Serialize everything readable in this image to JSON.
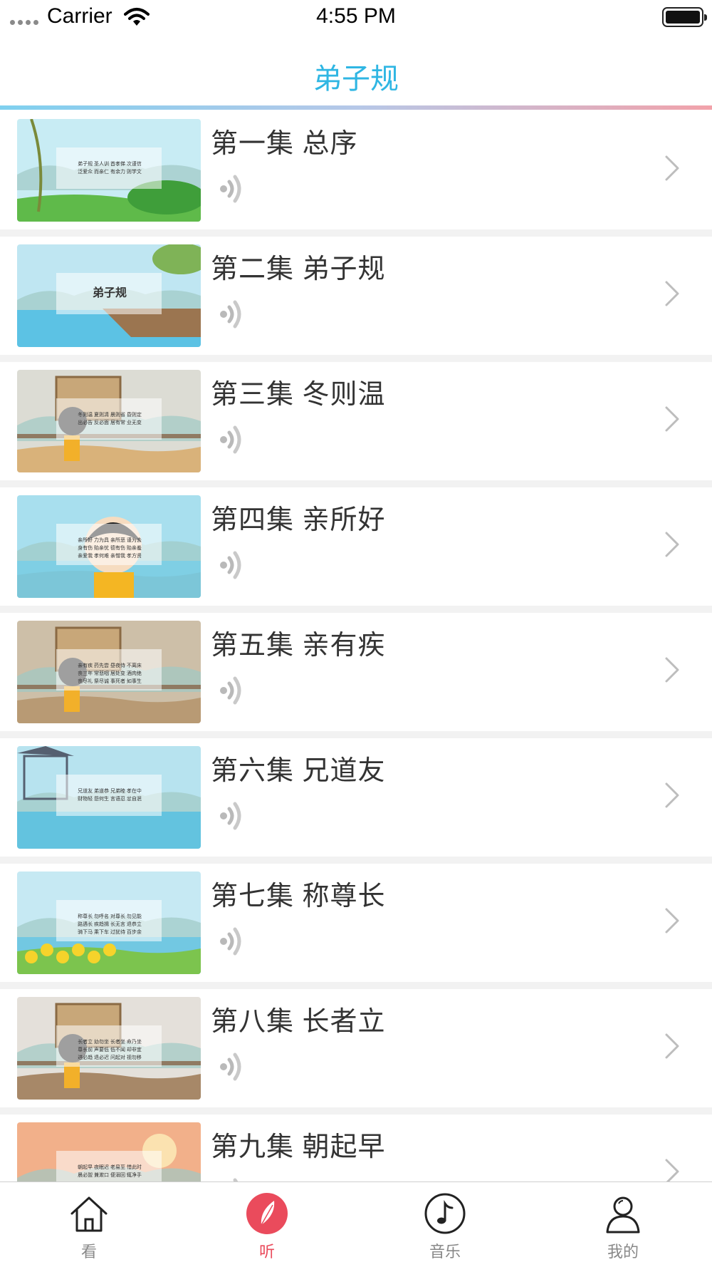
{
  "status": {
    "carrier": "Carrier",
    "time": "4:55 PM"
  },
  "nav": {
    "title": "弟子规"
  },
  "episodes": [
    {
      "title": "第一集 总序",
      "thumb_text": [
        "弟子规 圣人训 首孝悌 次谨信",
        "泛爱众 而亲仁 有余力 则学文"
      ]
    },
    {
      "title": "第二集 弟子规",
      "thumb_text": [
        "弟子规"
      ]
    },
    {
      "title": "第三集 冬则温",
      "thumb_text": [
        "冬则温 夏则凊 晨则省 昏则定",
        "出必告 反必面 居有常 业无变"
      ]
    },
    {
      "title": "第四集 亲所好",
      "thumb_text": [
        "亲所好 力为具 亲所恶 谨为去",
        "身有伤 贻亲忧 德有伤 贻亲羞",
        "亲爱我 孝何难 亲憎我 孝方贤"
      ]
    },
    {
      "title": "第五集 亲有疾",
      "thumb_text": [
        "亲有疾 药先尝 昼夜侍 不离床",
        "丧三年 常悲咽 居处变 酒肉绝",
        "丧尽礼 祭尽诚 事死者 如事生"
      ]
    },
    {
      "title": "第六集 兄道友",
      "thumb_text": [
        "兄道友 弟道恭 兄弟睦 孝在中",
        "财物轻 怨何生 言语忍 忿自泯"
      ]
    },
    {
      "title": "第七集 称尊长",
      "thumb_text": [
        "称尊长 勿呼名 对尊长 勿见能",
        "路遇长 疾趋揖 长无言 退恭立",
        "骑下马 乘下车 过犹待 百步余"
      ]
    },
    {
      "title": "第八集 长者立",
      "thumb_text": [
        "长者立 幼勿坐 长者坐 命乃坐",
        "尊长前 声要低 低不闻 却非宜",
        "进必趋 退必迟 问起对 视勿移"
      ]
    },
    {
      "title": "第九集 朝起早",
      "thumb_text": [
        "朝起早 夜眠迟 老易至 惜此时",
        "晨必盥 兼漱口 便溺回 辄净手"
      ]
    }
  ],
  "tabs": [
    {
      "label": "看",
      "icon": "home-icon",
      "active": false
    },
    {
      "label": "听",
      "icon": "listen-icon",
      "active": true
    },
    {
      "label": "音乐",
      "icon": "music-note-icon",
      "active": false
    },
    {
      "label": "我的",
      "icon": "profile-icon",
      "active": false
    }
  ],
  "colors": {
    "accent": "#2fb6e3",
    "active_tab": "#ea4b5c",
    "inactive_tab": "#888888"
  }
}
